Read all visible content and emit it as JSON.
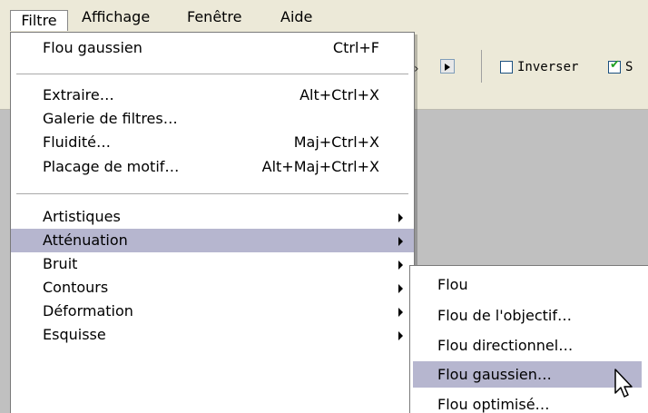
{
  "menubar": {
    "items": [
      "Filtre",
      "Affichage",
      "Fenêtre",
      "Aide"
    ]
  },
  "toolbar": {
    "partial_text": "›",
    "invert_label": "Inverser",
    "invert_checked": false,
    "second_label": "S",
    "second_checked": true
  },
  "menu": {
    "last_filter": {
      "label": "Flou gaussien",
      "shortcut": "Ctrl+F"
    },
    "group1": [
      {
        "label": "Extraire…",
        "shortcut": "Alt+Ctrl+X"
      },
      {
        "label": "Galerie de filtres…",
        "shortcut": ""
      },
      {
        "label": "Fluidité…",
        "shortcut": "Maj+Ctrl+X"
      },
      {
        "label": "Placage de motif…",
        "shortcut": "Alt+Maj+Ctrl+X"
      }
    ],
    "categories": [
      {
        "label": "Artistiques"
      },
      {
        "label": "Atténuation"
      },
      {
        "label": "Bruit"
      },
      {
        "label": "Contours"
      },
      {
        "label": "Déformation"
      },
      {
        "label": "Esquisse"
      }
    ]
  },
  "submenu": {
    "items": [
      "Flou",
      "Flou de l'objectif…",
      "Flou directionnel…",
      "Flou gaussien…",
      "Flou optimisé…"
    ]
  },
  "colors": {
    "menubar_bg": "#ece9d8",
    "highlight": "#b6b6cf",
    "workspace": "#c0c0c0"
  }
}
